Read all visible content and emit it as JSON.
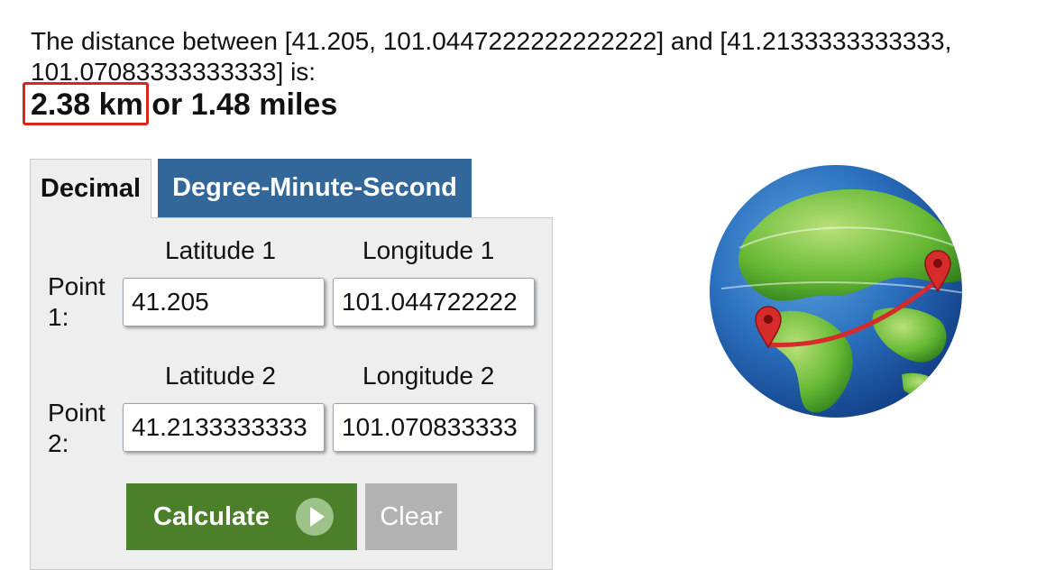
{
  "result": {
    "sentence": "The distance between [41.205, 101.0447222222222222] and [41.2133333333333, 101.07083333333333] is:",
    "km": "2.38 km",
    "miles": "or 1.48 miles"
  },
  "tabs": [
    {
      "label": "Decimal",
      "active": true
    },
    {
      "label": "Degree-Minute-Second",
      "active": false
    }
  ],
  "form": {
    "lat1_label": "Latitude 1",
    "lon1_label": "Longitude 1",
    "point1_label": "Point 1:",
    "lat1_value": "41.205",
    "lon1_value": "101.044722222",
    "lat2_label": "Latitude 2",
    "lon2_label": "Longitude 2",
    "point2_label": "Point 2:",
    "lat2_value": "41.2133333333",
    "lon2_value": "101.070833333"
  },
  "buttons": {
    "calculate": "Calculate",
    "clear": "Clear"
  },
  "colors": {
    "tab_active_bg": "#eeeeee",
    "tab_inactive_bg": "#336699",
    "calculate_bg": "#4b7f2a",
    "clear_bg": "#b2b2b2",
    "highlight": "#d9261c"
  },
  "icons": {
    "globe": "globe-with-route-icon",
    "calculate": "play-circle-icon"
  }
}
